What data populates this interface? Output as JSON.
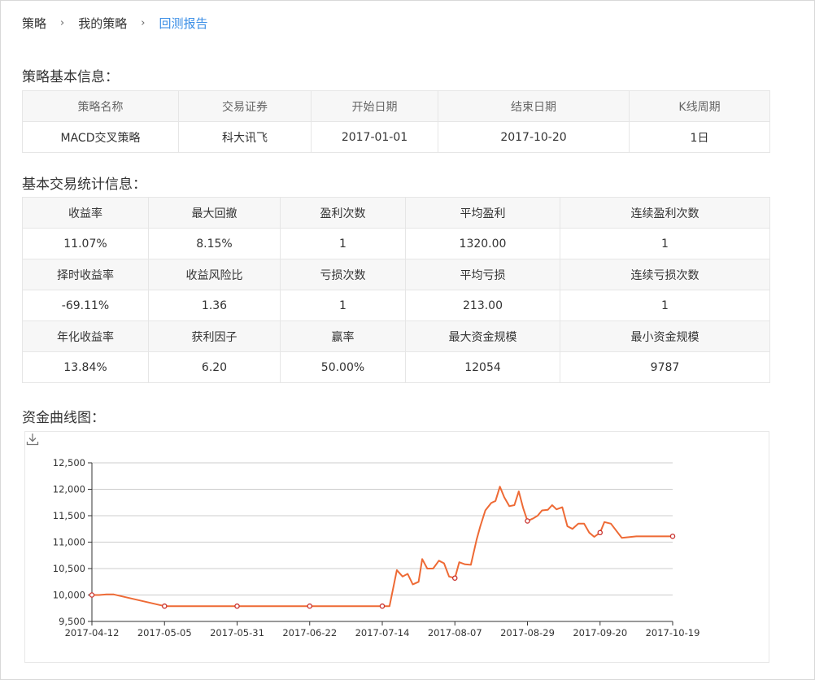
{
  "breadcrumb": [
    "策略",
    "我的策略",
    "回测报告"
  ],
  "sections": {
    "basic": "策略基本信息：",
    "stats": "基本交易统计信息：",
    "chart": "资金曲线图："
  },
  "basic_table": {
    "headers": [
      "策略名称",
      "交易证券",
      "开始日期",
      "结束日期",
      "K线周期"
    ],
    "values": [
      "MACD交叉策略",
      "科大讯飞",
      "2017-01-01",
      "2017-10-20",
      "1日"
    ]
  },
  "stats_table": {
    "rows": [
      {
        "headers": [
          "收益率",
          "最大回撤",
          "盈利次数",
          "平均盈利",
          "连续盈利次数"
        ],
        "values": [
          "11.07%",
          "8.15%",
          "1",
          "1320.00",
          "1"
        ]
      },
      {
        "headers": [
          "择时收益率",
          "收益风险比",
          "亏损次数",
          "平均亏损",
          "连续亏损次数"
        ],
        "values": [
          "-69.11%",
          "1.36",
          "1",
          "213.00",
          "1"
        ]
      },
      {
        "headers": [
          "年化收益率",
          "获利因子",
          "赢率",
          "最大资金规模",
          "最小资金规模"
        ],
        "values": [
          "13.84%",
          "6.20",
          "50.00%",
          "12054",
          "9787"
        ]
      }
    ]
  },
  "chart_data": {
    "type": "line",
    "title": "",
    "xlabel": "",
    "ylabel": "",
    "ylim": [
      9500,
      12500
    ],
    "yticks": [
      9500,
      10000,
      10500,
      11000,
      11500,
      12000,
      12500
    ],
    "ytick_labels": [
      "9,500",
      "10,000",
      "10,500",
      "11,000",
      "11,500",
      "12,000",
      "12,500"
    ],
    "xtick_labels": [
      "2017-04-12",
      "2017-05-05",
      "2017-05-31",
      "2017-06-22",
      "2017-07-14",
      "2017-08-07",
      "2017-08-29",
      "2017-09-20",
      "2017-10-19"
    ],
    "grid": true,
    "color": "#ee6a35",
    "x": [
      0,
      0.1,
      0.2,
      0.3,
      1,
      2,
      3,
      4,
      4.05,
      4.1,
      4.2,
      4.28,
      4.35,
      4.42,
      4.5,
      4.55,
      4.62,
      4.7,
      4.78,
      4.85,
      4.92,
      5.0,
      5.06,
      5.14,
      5.22,
      5.3,
      5.35,
      5.42,
      5.5,
      5.56,
      5.62,
      5.68,
      5.75,
      5.82,
      5.88,
      5.94,
      6.0,
      6.08,
      6.14,
      6.2,
      6.28,
      6.34,
      6.4,
      6.48,
      6.55,
      6.62,
      6.7,
      6.78,
      6.85,
      6.92,
      7.0,
      7.06,
      7.15,
      7.3,
      7.5,
      7.8,
      8.0
    ],
    "values": [
      10000,
      10000,
      10010,
      10010,
      9790,
      9790,
      9790,
      9790,
      9790,
      9790,
      10470,
      10350,
      10400,
      10200,
      10250,
      10680,
      10500,
      10500,
      10650,
      10600,
      10350,
      10320,
      10620,
      10580,
      10570,
      11050,
      11300,
      11600,
      11740,
      11780,
      12050,
      11850,
      11680,
      11700,
      11960,
      11650,
      11400,
      11450,
      11500,
      11600,
      11610,
      11700,
      11620,
      11660,
      11300,
      11250,
      11350,
      11350,
      11180,
      11100,
      11180,
      11380,
      11350,
      11080,
      11110,
      11110,
      11110
    ],
    "markers_at": [
      0,
      1,
      2,
      3,
      4,
      5,
      6,
      7,
      8
    ]
  }
}
